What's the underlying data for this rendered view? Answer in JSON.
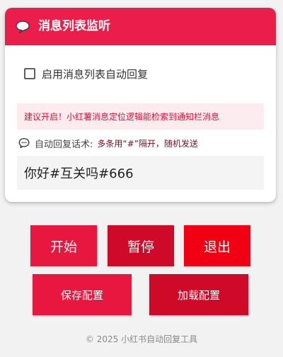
{
  "header": {
    "title": "消息列表监听",
    "icon": "speech-bubble-icon"
  },
  "auto_reply_toggle": {
    "label": "启用消息列表自动回复",
    "checked": false
  },
  "tip": {
    "text": "建议开启！小红薯消息定位逻辑能检索到通知栏消息"
  },
  "reply_section": {
    "icon": "speech-bubble-icon",
    "label": "自动回复话术:",
    "hint": "多条用“#”隔开，随机发送",
    "value": "你好#互关吗#666"
  },
  "buttons": {
    "start": "开始",
    "pause": "暂停",
    "exit": "退出",
    "save_config": "保存配置",
    "load_config": "加载配置"
  },
  "footer": {
    "text": "© 2025 小红书自动回复工具"
  },
  "colors": {
    "primary_red": "#eb1d4a",
    "dark_red": "#cf0a28",
    "bright_red": "#f00012",
    "tip_background": "#fdecef"
  }
}
